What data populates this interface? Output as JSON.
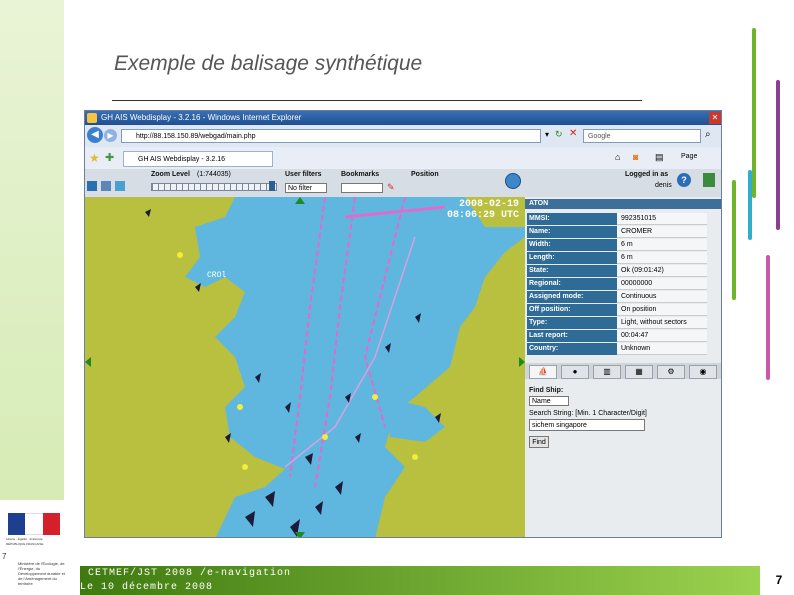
{
  "slide": {
    "title": "Exemple  de balisage synthétique",
    "footer_line1": "CETMEF/JST 2008 /e-navigation",
    "footer_line2": "Le 10 décembre 2008",
    "page_number": "7",
    "side_number": "7",
    "logo_text_1": "Liberté · Égalité · Fraternité",
    "logo_text_2": "RÉPUBLIQUE FRANÇAISE",
    "ministry_text": "Ministère de l'Écologie, de l'Énergie, du Développement durable et de l'Aménagement du territoire"
  },
  "browser": {
    "window_title": "GH AIS Webdisplay - 3.2.16 - Windows Internet Explorer",
    "address": "http://88.158.150.89/webgad/main.php",
    "search_placeholder": "Google",
    "tab_label": "GH AIS Webdisplay - 3.2.16",
    "page_menu": "Page",
    "colors": {
      "titlebar": "#1f4f92",
      "sea": "#5fb7df",
      "land": "#b9bf3f",
      "panel_key": "#2f6b97"
    }
  },
  "app": {
    "zoom_label": "Zoom Level",
    "zoom_value": "(1:744035)",
    "user_filters_label": "User filters",
    "user_filters_value": "No filter",
    "bookmarks_label": "Bookmarks",
    "position_label": "Position",
    "logged_in_label": "Logged in as",
    "user": "denis",
    "timestamp_date": "2008-02-19",
    "timestamp_time": "08:06:29 UTC",
    "map_label": "CROl"
  },
  "panel": {
    "header": "ATON",
    "fields": [
      {
        "k": "MMSI:",
        "v": "992351015"
      },
      {
        "k": "Name:",
        "v": "CROMER"
      },
      {
        "k": "Width:",
        "v": "6 m"
      },
      {
        "k": "Length:",
        "v": "6 m"
      },
      {
        "k": "State:",
        "v": "Ok (09:01:42)"
      },
      {
        "k": "Regional:",
        "v": "00000000"
      },
      {
        "k": "Assigned mode:",
        "v": "Continuous"
      },
      {
        "k": "Off position:",
        "v": "On position"
      },
      {
        "k": "Type:",
        "v": "Light, without sectors"
      },
      {
        "k": "Last report:",
        "v": "00:04:47"
      },
      {
        "k": "Country:",
        "v": "Unknown"
      }
    ],
    "find_ship_label": "Find Ship:",
    "find_by_value": "Name",
    "search_string_label": "Search String: [Min. 1 Character/Digit]",
    "search_value": "sichem singapore",
    "find_button": "Find"
  }
}
